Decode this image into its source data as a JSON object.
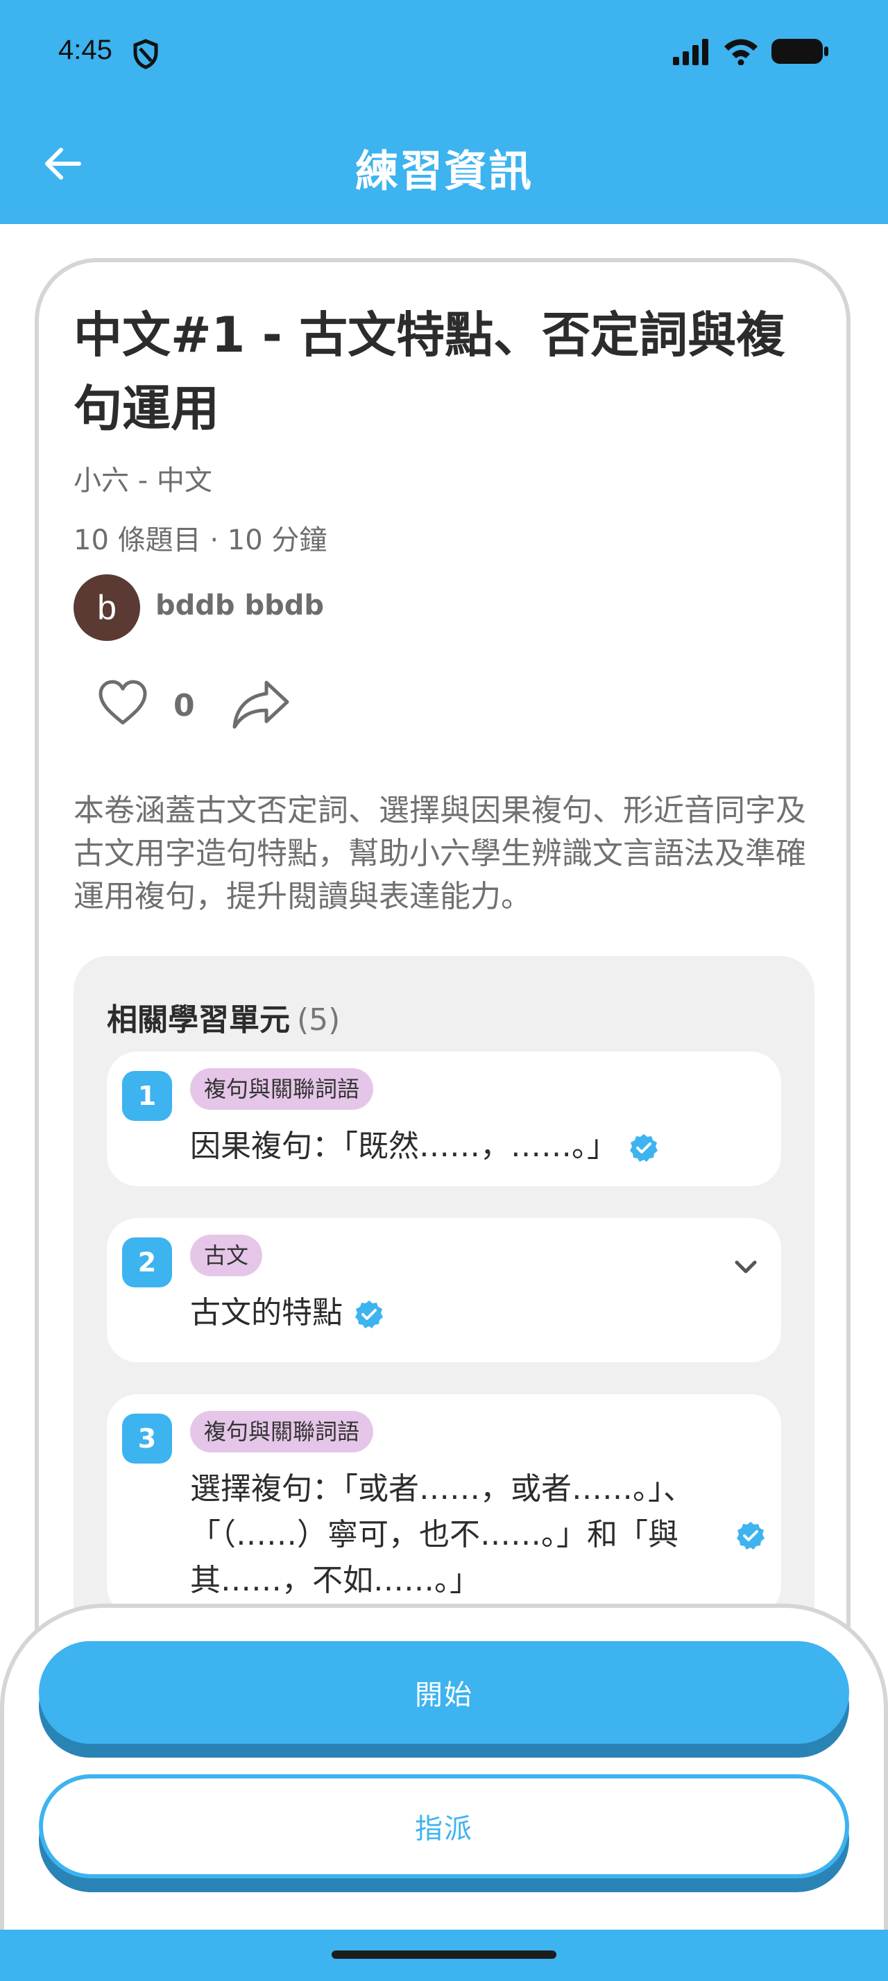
{
  "status_bar": {
    "time": "4:45",
    "left_icons": [
      "shield-icon"
    ],
    "right_icons": [
      "signal-icon",
      "wifi-icon",
      "battery-icon"
    ]
  },
  "app_bar": {
    "title": "練習資訊",
    "back_icon": "arrow-left-icon"
  },
  "quiz": {
    "title": "中文#1 - 古文特點、否定詞與複句運用",
    "subject": "小六 - 中文",
    "meta": "10 條題目 · 10 分鐘",
    "author": {
      "initial": "b",
      "name": "bddb bbdb"
    },
    "likes": "0",
    "description": "本卷涵蓋古文否定詞、選擇與因果複句、形近音同字及古文用字造句特點，幫助小六學生辨識文言語法及準確運用複句，提升閱讀與表達能力。"
  },
  "units": {
    "heading": "相關學習單元",
    "count": "(5)",
    "items": [
      {
        "number": "1",
        "tag": "複句與關聯詞語",
        "text": "因果複句：「既然……，……。」"
      },
      {
        "number": "2",
        "tag": "古文",
        "text": "古文的特點"
      },
      {
        "number": "3",
        "tag": "複句與關聯詞語",
        "text": "選擇複句：「或者……，或者……。」、「（……）寧可，也不……。」和「與其……，不如……。」"
      }
    ]
  },
  "actions": {
    "start_label": "開始",
    "assign_label": "指派"
  },
  "colors": {
    "primary": "#3DB3F0",
    "primary_shadow": "#2A83B5",
    "tag_bg": "#E5C6E8",
    "avatar_bg": "#5B3A33",
    "panel_bg": "#F0F0F0"
  }
}
